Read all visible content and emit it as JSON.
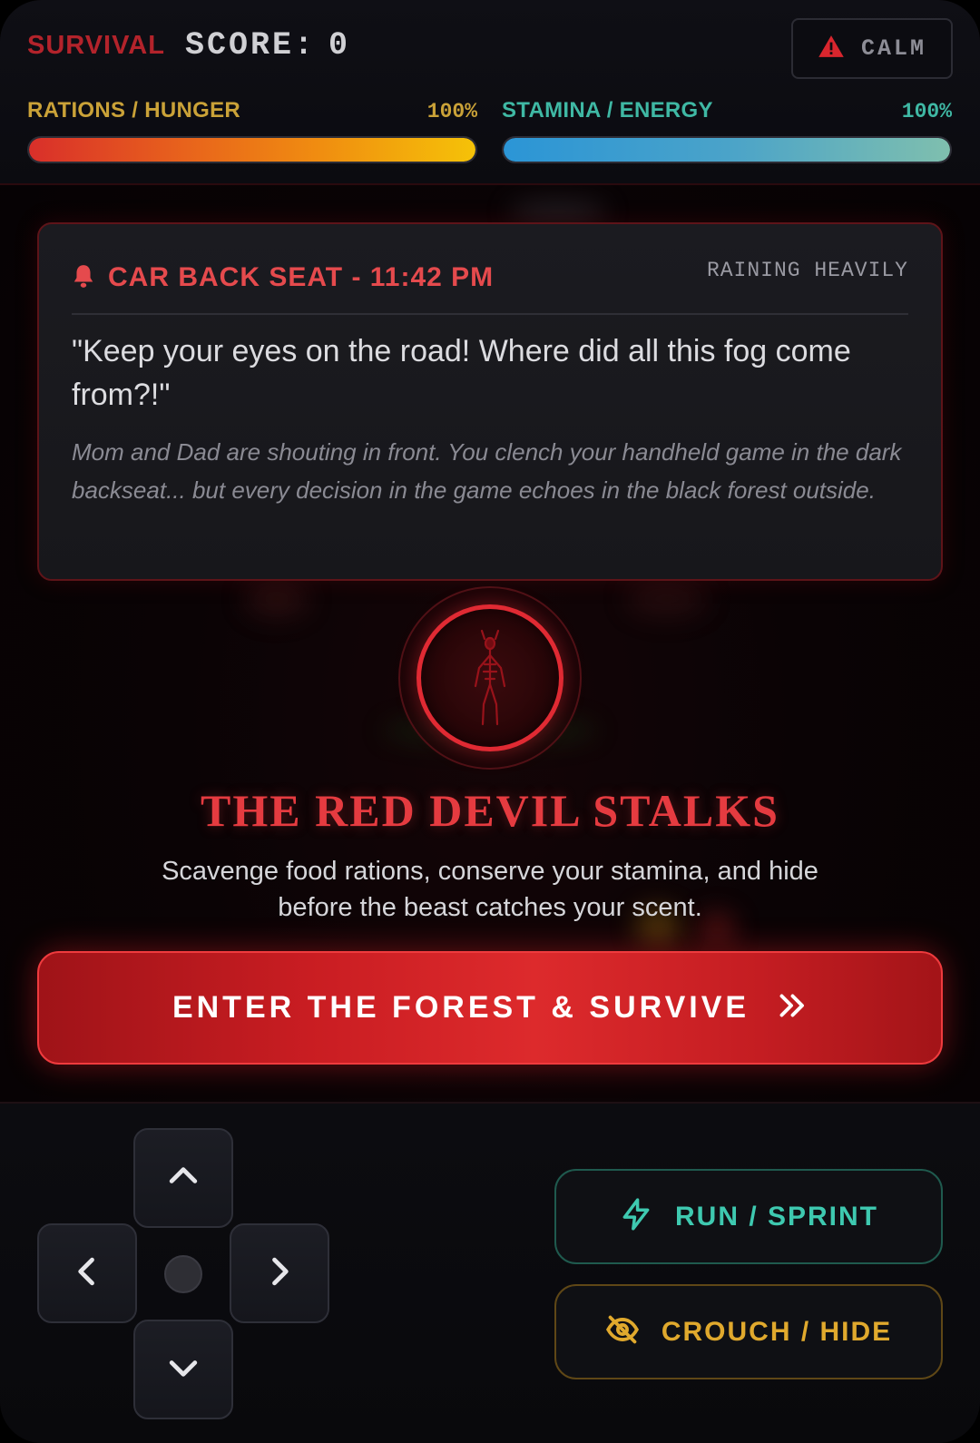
{
  "hud": {
    "title": "SURVIVAL",
    "score_label": "SCORE:",
    "score_value": "0",
    "status": {
      "label": "CALM",
      "icon": "warning-triangle-icon",
      "color": "#d9262e"
    }
  },
  "meters": {
    "hunger": {
      "label": "RATIONS / HUNGER",
      "value_text": "100%",
      "level": 1.0
    },
    "stamina": {
      "label": "STAMINA / ENERGY",
      "value_text": "100%",
      "level": 1.0
    }
  },
  "story": {
    "icon": "bell-icon",
    "location": "CAR BACK SEAT - 11:42 PM",
    "weather": "RAINING HEAVILY",
    "quote": "\"Keep your eyes on the road! Where did all this fog come from?!\"",
    "narration": "Mom and Dad are shouting in front. You clench your handheld game in the dark backseat... but every decision in the game echoes in the black forest outside."
  },
  "intro": {
    "emblem_icon": "red-devil-figure-icon",
    "headline": "THE RED DEVIL STALKS",
    "subline": "Scavenge food rations, conserve your stamina, and hide before the beast catches your scent."
  },
  "cta": {
    "label": "ENTER THE FOREST & SURVIVE",
    "icon": "chevrons-right-icon"
  },
  "controls": {
    "dpad": [
      "chevron-up-icon",
      "chevron-left-icon",
      "chevron-right-icon",
      "chevron-down-icon"
    ],
    "run": {
      "label": "RUN / SPRINT",
      "icon": "lightning-icon",
      "color": "#3ec9b0"
    },
    "hide": {
      "label": "CROUCH / HIDE",
      "icon": "eye-off-icon",
      "color": "#e0a92d"
    }
  }
}
